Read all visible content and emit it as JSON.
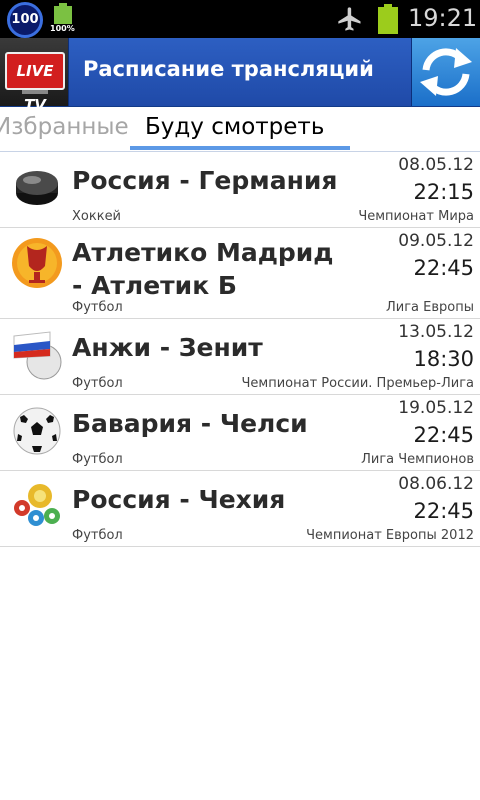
{
  "status_bar": {
    "notification_count": "100",
    "battery_small_label": "100%",
    "time": "19:21"
  },
  "title_bar": {
    "logo_text": "LIVE TV",
    "title": "Расписание трансляций",
    "refresh_icon": "refresh-icon"
  },
  "tabs": [
    {
      "label": "Избранные",
      "active": false
    },
    {
      "label": "Буду смотреть",
      "active": true
    }
  ],
  "events": [
    {
      "title": "Россия - Германия",
      "date": "08.05.12",
      "time": "22:15",
      "sport": "Хоккей",
      "league": "Чемпионат Мира",
      "icon": "hockey-puck-icon"
    },
    {
      "title": "Атлетико Мадрид - Атлетик Б",
      "date": "09.05.12",
      "time": "22:45",
      "sport": "Футбол",
      "league": "Лига Европы",
      "icon": "europa-league-icon"
    },
    {
      "title": "Анжи - Зенит",
      "date": "13.05.12",
      "time": "18:30",
      "sport": "Футбол",
      "league": "Чемпионат России. Премьер-Лига",
      "icon": "russian-flag-ball-icon"
    },
    {
      "title": "Бавария - Челси",
      "date": "19.05.12",
      "time": "22:45",
      "sport": "Футбол",
      "league": "Лига Чемпионов",
      "icon": "champions-league-ball-icon"
    },
    {
      "title": "Россия - Чехия",
      "date": "08.06.12",
      "time": "22:45",
      "sport": "Футбол",
      "league": "Чемпионат Европы 2012",
      "icon": "euro-2012-icon"
    }
  ],
  "colors": {
    "title_bar": "#2552b4",
    "tab_indicator": "#5c99e6",
    "status_battery": "#9ccc1c"
  }
}
